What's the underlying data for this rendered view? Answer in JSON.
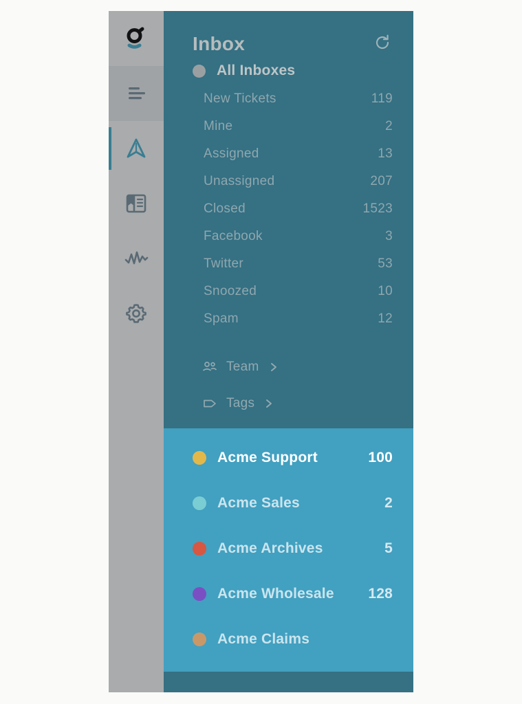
{
  "colors": {
    "page_background": "#fafaf9",
    "rail_background": "#a9abad",
    "panel_background": "#357083",
    "mailbox_group_background": "#42a0c0",
    "accent_teal": "#3a7d91",
    "muted_text": "#8fa7ae",
    "title_text": "#b6bcbd"
  },
  "rail": {
    "items": [
      {
        "icon": "brand-logo-icon",
        "name": "brand-logo",
        "state": "logo"
      },
      {
        "icon": "menu-lines-icon",
        "name": "rail-item-menu",
        "state": "highlight"
      },
      {
        "icon": "navigation-arrow-icon",
        "name": "rail-item-conversations",
        "state": "active"
      },
      {
        "icon": "book-icon",
        "name": "rail-item-knowledge-base",
        "state": "default"
      },
      {
        "icon": "activity-pulse-icon",
        "name": "rail-item-reports",
        "state": "default"
      },
      {
        "icon": "gear-icon",
        "name": "rail-item-settings",
        "state": "default"
      }
    ]
  },
  "header": {
    "title": "Inbox",
    "refresh_icon": "refresh-icon"
  },
  "all_inboxes": {
    "label": "All Inboxes",
    "dot_color": "#9aa0a2"
  },
  "folders": [
    {
      "label": "New Tickets",
      "count": "119"
    },
    {
      "label": "Mine",
      "count": "2"
    },
    {
      "label": "Assigned",
      "count": "13"
    },
    {
      "label": "Unassigned",
      "count": "207"
    },
    {
      "label": "Closed",
      "count": "1523"
    },
    {
      "label": "Facebook",
      "count": "3"
    },
    {
      "label": "Twitter",
      "count": "53"
    },
    {
      "label": "Snoozed",
      "count": "10"
    },
    {
      "label": "Spam",
      "count": "12"
    }
  ],
  "groups": [
    {
      "label": "Team",
      "icon": "people-icon",
      "chevron": "chevron-right-icon"
    },
    {
      "label": "Tags",
      "icon": "tag-icon",
      "chevron": "chevron-right-icon"
    }
  ],
  "mailboxes": [
    {
      "label": "Acme Support",
      "count": "100",
      "dot_color": "#e3b84a",
      "selected": true
    },
    {
      "label": "Acme Sales",
      "count": "2",
      "dot_color": "#7bcdd4",
      "selected": false
    },
    {
      "label": "Acme Archives",
      "count": "5",
      "dot_color": "#d65742",
      "selected": false
    },
    {
      "label": "Acme Wholesale",
      "count": "128",
      "dot_color": "#7b4fc4",
      "selected": false
    },
    {
      "label": "Acme Claims",
      "count": "",
      "dot_color": "#c99868",
      "selected": false
    }
  ]
}
